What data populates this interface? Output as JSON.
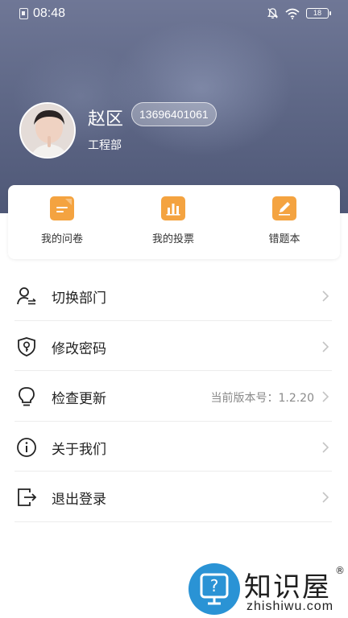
{
  "status_bar": {
    "time": "08:48",
    "battery": "18",
    "icons": [
      "sim-icon",
      "bell-off-icon",
      "wifi-icon",
      "battery-icon"
    ]
  },
  "profile": {
    "name": "赵区",
    "phone": "13696401061",
    "department": "工程部"
  },
  "quick_actions": [
    {
      "label": "我的问卷",
      "icon": "questionnaire-icon"
    },
    {
      "label": "我的投票",
      "icon": "vote-chart-icon"
    },
    {
      "label": "错题本",
      "icon": "edit-pencil-icon"
    }
  ],
  "menu": [
    {
      "label": "切换部门",
      "icon": "switch-user-icon",
      "value": ""
    },
    {
      "label": "修改密码",
      "icon": "shield-key-icon",
      "value": ""
    },
    {
      "label": "检查更新",
      "icon": "lightbulb-icon",
      "value": "当前版本号：1.2.20"
    },
    {
      "label": "关于我们",
      "icon": "info-icon",
      "value": ""
    },
    {
      "label": "退出登录",
      "icon": "logout-icon",
      "value": ""
    }
  ],
  "watermark": {
    "brand": "知识屋",
    "registered": "®",
    "domain": "zhishiwu.com"
  },
  "colors": {
    "accent": "#f4a340",
    "header": "#5f6887",
    "watermark_blue": "#2a93d5"
  }
}
